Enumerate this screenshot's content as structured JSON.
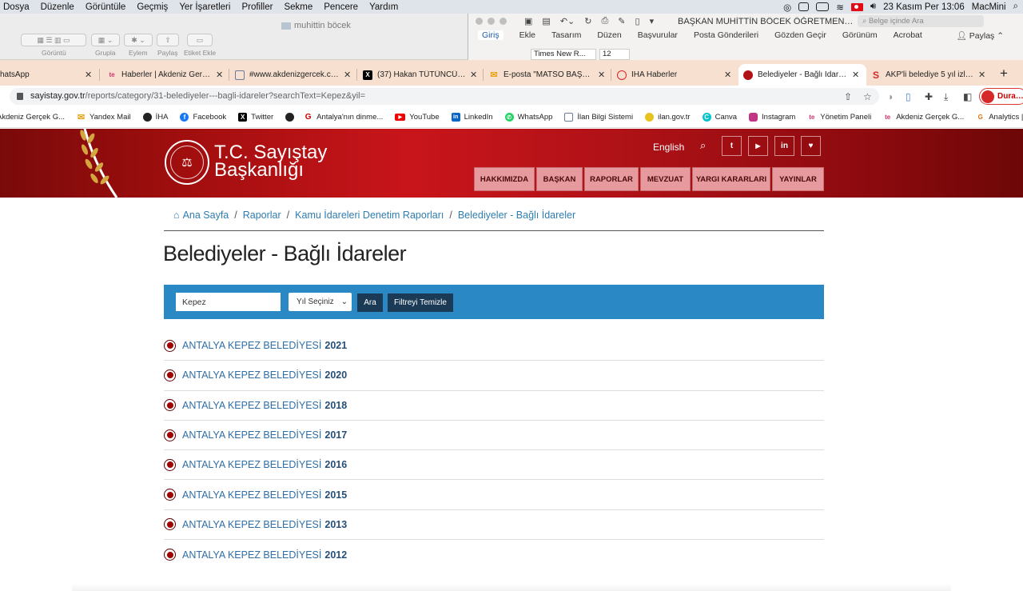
{
  "menubar": {
    "items": [
      "Dosya",
      "Düzenle",
      "Görüntüle",
      "Geçmiş",
      "Yer İşaretleri",
      "Profiller",
      "Sekme",
      "Pencere",
      "Yardım"
    ],
    "datetime": "23 Kasım Per  13:06",
    "machine": "MacMini"
  },
  "finder": {
    "title": "muhittin böcek",
    "labels": [
      "Görüntü",
      "Grupla",
      "Eylem",
      "Paylaş",
      "Etiket Ekle"
    ]
  },
  "word": {
    "title": "BAŞKAN MUHİTTİN BÖCEK ÖĞRETMENLE...",
    "search_placeholder": "Belge içinde Ara",
    "tabs": [
      "Giriş",
      "Ekle",
      "Tasarım",
      "Düzen",
      "Başvurular",
      "Posta Gönderileri",
      "Gözden Geçir",
      "Görünüm",
      "Acrobat"
    ],
    "share": "Paylaş",
    "font": "Times New R...",
    "size": "12"
  },
  "tabs": [
    {
      "title": "hatsApp",
      "color": "#25d366",
      "glyph": ""
    },
    {
      "title": "Haberler | Akdeniz Gerçek",
      "color": "#d6306f",
      "glyph": "te"
    },
    {
      "title": "#www.akdenizgercek.com",
      "color": "#6b7b9a",
      "glyph": ""
    },
    {
      "title": "(37) Hakan TÜTÜNCÜ (@",
      "color": "#000",
      "glyph": "X"
    },
    {
      "title": "E-posta \"MATSO BAŞKAN",
      "color": "#e8a317",
      "glyph": ""
    },
    {
      "title": "İHA Haberler",
      "color": "#d62828",
      "glyph": ""
    },
    {
      "title": "Belediyeler - Bağlı İdarele",
      "color": "#b01217",
      "glyph": ""
    },
    {
      "title": "AKP'li belediye 5 yıl izlem",
      "color": "#d62828",
      "glyph": "S"
    }
  ],
  "address": {
    "domain": "sayistay.gov.tr",
    "path": "/reports/category/31-belediyeler---bagli-idareler?searchText=Kepez&yil=",
    "profile": "Duraklat"
  },
  "bookmarks": [
    {
      "label": "Akdeniz Gerçek G...",
      "color": "#d6306f",
      "glyph": "te"
    },
    {
      "label": "Yandex Mail",
      "color": "#e8a317",
      "glyph": "✉"
    },
    {
      "label": "İHA",
      "color": "#222",
      "glyph": ""
    },
    {
      "label": "Facebook",
      "color": "#1877f2",
      "glyph": "f"
    },
    {
      "label": "Twitter",
      "color": "#000",
      "glyph": "X"
    },
    {
      "label": "",
      "color": "#222",
      "glyph": ""
    },
    {
      "label": "Antalya'nın dinme...",
      "color": "#c00",
      "glyph": "G"
    },
    {
      "label": "YouTube",
      "color": "#e00",
      "glyph": "▶"
    },
    {
      "label": "LinkedIn",
      "color": "#0a66c2",
      "glyph": "in"
    },
    {
      "label": "WhatsApp",
      "color": "#25d366",
      "glyph": "✆"
    },
    {
      "label": "İlan Bilgi Sistemi",
      "color": "#6b7b9a",
      "glyph": ""
    },
    {
      "label": "ilan.gov.tr",
      "color": "#e8c320",
      "glyph": ""
    },
    {
      "label": "Canva",
      "color": "#00c4cc",
      "glyph": "C"
    },
    {
      "label": "Instagram",
      "color": "#c13584",
      "glyph": ""
    },
    {
      "label": "Yönetim Paneli",
      "color": "#d6306f",
      "glyph": "te"
    },
    {
      "label": "Akdeniz Gerçek G...",
      "color": "#d6306f",
      "glyph": "te"
    },
    {
      "label": "Analytics | Ana",
      "color": "#e8710a",
      "glyph": "G"
    }
  ],
  "site": {
    "logo_text": "SAYIŞTAY",
    "name_line1": "T.C. Sayıştay",
    "name_line2": "Başkanlığı",
    "lang": "English",
    "social": [
      "t",
      "▶",
      "in",
      "♥"
    ],
    "nav": [
      "HAKKIMIZDA",
      "BAŞKAN",
      "RAPORLAR",
      "MEVZUAT",
      "YARGI KARARLARI",
      "YAYINLAR"
    ]
  },
  "breadcrumb": {
    "home": "Ana Sayfa",
    "items": [
      "Raporlar",
      "Kamu İdareleri Denetim Raporları",
      "Belediyeler - Bağlı İdareler"
    ]
  },
  "page_title": "Belediyeler - Bağlı İdareler",
  "filter": {
    "search_value": "Kepez",
    "year_select": "Yıl Seçiniz",
    "search_button": "Ara",
    "clear_button": "Filtreyi Temizle"
  },
  "reports": [
    {
      "name": "ANTALYA KEPEZ BELEDİYESİ",
      "year": "2021"
    },
    {
      "name": "ANTALYA KEPEZ BELEDİYESİ",
      "year": "2020"
    },
    {
      "name": "ANTALYA KEPEZ BELEDİYESİ",
      "year": "2018"
    },
    {
      "name": "ANTALYA KEPEZ BELEDİYESİ",
      "year": "2017"
    },
    {
      "name": "ANTALYA KEPEZ BELEDİYESİ",
      "year": "2016"
    },
    {
      "name": "ANTALYA KEPEZ BELEDİYESİ",
      "year": "2015"
    },
    {
      "name": "ANTALYA KEPEZ BELEDİYESİ",
      "year": "2013"
    },
    {
      "name": "ANTALYA KEPEZ BELEDİYESİ",
      "year": "2012"
    }
  ]
}
